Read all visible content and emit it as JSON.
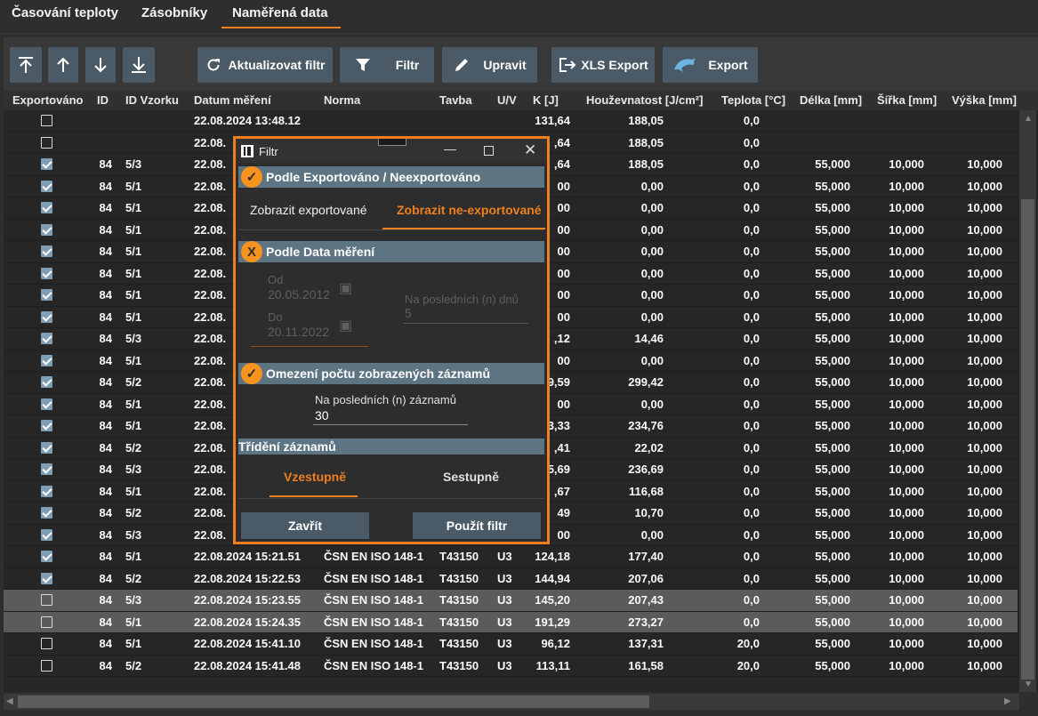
{
  "tabs": {
    "t1": "Časování teploty",
    "t2": "Zásobníky",
    "t3": "Naměřená data"
  },
  "toolbar": {
    "refresh": "Aktualizovat filtr",
    "filter": "Filtr",
    "edit": "Upravit",
    "xls": "XLS Export",
    "export": "Export"
  },
  "columns": [
    "Exportováno",
    "ID",
    "ID Vzorku",
    "Datum měření",
    "Norma",
    "Tavba",
    "U/V",
    "K [J]",
    "Houževnatost [J/cm²]",
    "Teplota [°C]",
    "Délka [mm]",
    "Šířka [mm]",
    "Výška [mm]"
  ],
  "rows": [
    {
      "exp": false,
      "id": "",
      "vz": "",
      "date": "22.08.2024 13:48.12",
      "norma": "",
      "tavba": "",
      "uv": "",
      "k": "131,64",
      "h": "188,05",
      "t": "0,0",
      "d": "",
      "s": "",
      "v": ""
    },
    {
      "exp": false,
      "id": "",
      "vz": "",
      "date": "22.08.",
      "norma": "",
      "tavba": "",
      "uv": "",
      "k": ",64",
      "h": "188,05",
      "t": "0,0",
      "d": "",
      "s": "",
      "v": ""
    },
    {
      "exp": true,
      "id": "84",
      "vz": "5/3",
      "date": "22.08.",
      "norma": "",
      "tavba": "",
      "uv": "",
      "k": ",64",
      "h": "188,05",
      "t": "0,0",
      "d": "55,000",
      "s": "10,000",
      "v": "10,000"
    },
    {
      "exp": true,
      "id": "84",
      "vz": "5/1",
      "date": "22.08.",
      "norma": "",
      "tavba": "",
      "uv": "",
      "k": "00",
      "h": "0,00",
      "t": "0,0",
      "d": "55,000",
      "s": "10,000",
      "v": "10,000"
    },
    {
      "exp": true,
      "id": "84",
      "vz": "5/1",
      "date": "22.08.",
      "norma": "",
      "tavba": "",
      "uv": "",
      "k": "00",
      "h": "0,00",
      "t": "0,0",
      "d": "55,000",
      "s": "10,000",
      "v": "10,000"
    },
    {
      "exp": true,
      "id": "84",
      "vz": "5/1",
      "date": "22.08.",
      "norma": "",
      "tavba": "",
      "uv": "",
      "k": "00",
      "h": "0,00",
      "t": "0,0",
      "d": "55,000",
      "s": "10,000",
      "v": "10,000"
    },
    {
      "exp": true,
      "id": "84",
      "vz": "5/1",
      "date": "22.08.",
      "norma": "",
      "tavba": "",
      "uv": "",
      "k": "00",
      "h": "0,00",
      "t": "0,0",
      "d": "55,000",
      "s": "10,000",
      "v": "10,000"
    },
    {
      "exp": true,
      "id": "84",
      "vz": "5/1",
      "date": "22.08.",
      "norma": "",
      "tavba": "",
      "uv": "",
      "k": "00",
      "h": "0,00",
      "t": "0,0",
      "d": "55,000",
      "s": "10,000",
      "v": "10,000"
    },
    {
      "exp": true,
      "id": "84",
      "vz": "5/1",
      "date": "22.08.",
      "norma": "",
      "tavba": "",
      "uv": "",
      "k": "00",
      "h": "0,00",
      "t": "0,0",
      "d": "55,000",
      "s": "10,000",
      "v": "10,000"
    },
    {
      "exp": true,
      "id": "84",
      "vz": "5/1",
      "date": "22.08.",
      "norma": "",
      "tavba": "",
      "uv": "",
      "k": "00",
      "h": "0,00",
      "t": "0,0",
      "d": "55,000",
      "s": "10,000",
      "v": "10,000"
    },
    {
      "exp": true,
      "id": "84",
      "vz": "5/3",
      "date": "22.08.",
      "norma": "",
      "tavba": "",
      "uv": "",
      "k": ",12",
      "h": "14,46",
      "t": "0,0",
      "d": "55,000",
      "s": "10,000",
      "v": "10,000"
    },
    {
      "exp": true,
      "id": "84",
      "vz": "5/1",
      "date": "22.08.",
      "norma": "",
      "tavba": "",
      "uv": "",
      "k": "00",
      "h": "0,00",
      "t": "0,0",
      "d": "55,000",
      "s": "10,000",
      "v": "10,000"
    },
    {
      "exp": true,
      "id": "84",
      "vz": "5/2",
      "date": "22.08.",
      "norma": "",
      "tavba": "",
      "uv": "",
      "k": "9,59",
      "h": "299,42",
      "t": "0,0",
      "d": "55,000",
      "s": "10,000",
      "v": "10,000"
    },
    {
      "exp": true,
      "id": "84",
      "vz": "5/1",
      "date": "22.08.",
      "norma": "",
      "tavba": "",
      "uv": "",
      "k": "00",
      "h": "0,00",
      "t": "0,0",
      "d": "55,000",
      "s": "10,000",
      "v": "10,000"
    },
    {
      "exp": true,
      "id": "84",
      "vz": "5/1",
      "date": "22.08.",
      "norma": "",
      "tavba": "",
      "uv": "",
      "k": "3,33",
      "h": "234,76",
      "t": "0,0",
      "d": "55,000",
      "s": "10,000",
      "v": "10,000"
    },
    {
      "exp": true,
      "id": "84",
      "vz": "5/2",
      "date": "22.08.",
      "norma": "",
      "tavba": "",
      "uv": "",
      "k": ",41",
      "h": "22,02",
      "t": "0,0",
      "d": "55,000",
      "s": "10,000",
      "v": "10,000"
    },
    {
      "exp": true,
      "id": "84",
      "vz": "5/3",
      "date": "22.08.",
      "norma": "",
      "tavba": "",
      "uv": "",
      "k": "5,69",
      "h": "236,69",
      "t": "0,0",
      "d": "55,000",
      "s": "10,000",
      "v": "10,000"
    },
    {
      "exp": true,
      "id": "84",
      "vz": "5/1",
      "date": "22.08.",
      "norma": "",
      "tavba": "",
      "uv": "",
      "k": ",67",
      "h": "116,68",
      "t": "0,0",
      "d": "55,000",
      "s": "10,000",
      "v": "10,000"
    },
    {
      "exp": true,
      "id": "84",
      "vz": "5/2",
      "date": "22.08.",
      "norma": "",
      "tavba": "",
      "uv": "",
      "k": "49",
      "h": "10,70",
      "t": "0,0",
      "d": "55,000",
      "s": "10,000",
      "v": "10,000"
    },
    {
      "exp": true,
      "id": "84",
      "vz": "5/3",
      "date": "22.08.",
      "norma": "",
      "tavba": "",
      "uv": "",
      "k": "00",
      "h": "0,00",
      "t": "0,0",
      "d": "55,000",
      "s": "10,000",
      "v": "10,000"
    },
    {
      "exp": true,
      "id": "84",
      "vz": "5/1",
      "date": "22.08.2024 15:21.51",
      "norma": "ČSN EN ISO 148-1",
      "tavba": "T43150",
      "uv": "U3",
      "k": "124,18",
      "h": "177,40",
      "t": "0,0",
      "d": "55,000",
      "s": "10,000",
      "v": "10,000"
    },
    {
      "exp": true,
      "id": "84",
      "vz": "5/2",
      "date": "22.08.2024 15:22.53",
      "norma": "ČSN EN ISO 148-1",
      "tavba": "T43150",
      "uv": "U3",
      "k": "144,94",
      "h": "207,06",
      "t": "0,0",
      "d": "55,000",
      "s": "10,000",
      "v": "10,000"
    },
    {
      "exp": false,
      "id": "84",
      "vz": "5/3",
      "date": "22.08.2024 15:23.55",
      "norma": "ČSN EN ISO 148-1",
      "tavba": "T43150",
      "uv": "U3",
      "k": "145,20",
      "h": "207,43",
      "t": "0,0",
      "d": "55,000",
      "s": "10,000",
      "v": "10,000",
      "sel": true
    },
    {
      "exp": false,
      "id": "84",
      "vz": "5/1",
      "date": "22.08.2024 15:24.35",
      "norma": "ČSN EN ISO 148-1",
      "tavba": "T43150",
      "uv": "U3",
      "k": "191,29",
      "h": "273,27",
      "t": "0,0",
      "d": "55,000",
      "s": "10,000",
      "v": "10,000",
      "sel": true
    },
    {
      "exp": false,
      "id": "84",
      "vz": "5/1",
      "date": "22.08.2024 15:41.10",
      "norma": "ČSN EN ISO 148-1",
      "tavba": "T43150",
      "uv": "U3",
      "k": "96,12",
      "h": "137,31",
      "t": "20,0",
      "d": "55,000",
      "s": "10,000",
      "v": "10,000"
    },
    {
      "exp": false,
      "id": "84",
      "vz": "5/2",
      "date": "22.08.2024 15:41.48",
      "norma": "ČSN EN ISO 148-1",
      "tavba": "T43150",
      "uv": "U3",
      "k": "113,11",
      "h": "161,58",
      "t": "20,0",
      "d": "55,000",
      "s": "10,000",
      "v": "10,000"
    }
  ],
  "dialog": {
    "title": "Filtr",
    "s1": {
      "title": "Podle Exportováno / Neexportováno",
      "opt1": "Zobrazit exportované",
      "opt2": "Zobrazit ne-exportované"
    },
    "s2": {
      "title": "Podle Data měření",
      "from_label": "Od",
      "from_value": "20.05.2012",
      "to_label": "Do",
      "to_value": "20.11.2022",
      "lastdays_label": "Na posledních (n) dnů",
      "lastdays_value": "5"
    },
    "s3": {
      "title": "Omezení počtu zobrazených záznamů",
      "label": "Na posledních (n) záznamů",
      "value": "30"
    },
    "s4": {
      "title": "Třídění záznamů",
      "asc": "Vzestupně",
      "desc": "Sestupně"
    },
    "close": "Zavřít",
    "apply": "Použít filtr"
  },
  "colors": {
    "accent": "#f07f1f",
    "button": "#4a5a66",
    "section": "#5d7482"
  }
}
